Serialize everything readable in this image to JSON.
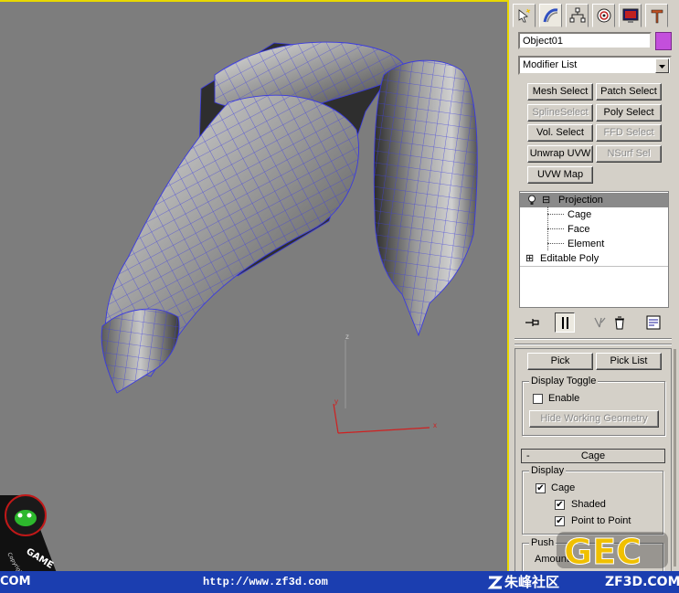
{
  "command_panel": {
    "tabs": [
      "create-icon",
      "modify-icon",
      "hierarchy-icon",
      "motion-icon",
      "display-icon",
      "utilities-icon"
    ],
    "object_name": "Object01",
    "object_color": "#c34fdc",
    "modifier_list_label": "Modifier List",
    "modifier_buttons": [
      {
        "label": "Mesh Select",
        "enabled": true
      },
      {
        "label": "Patch Select",
        "enabled": true
      },
      {
        "label": "SplineSelect",
        "enabled": false
      },
      {
        "label": "Poly Select",
        "enabled": true
      },
      {
        "label": "Vol. Select",
        "enabled": true
      },
      {
        "label": "FFD Select",
        "enabled": false
      },
      {
        "label": "Unwrap UVW",
        "enabled": true
      },
      {
        "label": "NSurf Sel",
        "enabled": false
      },
      {
        "label": "UVW Map",
        "enabled": true
      }
    ],
    "stack": {
      "items": [
        {
          "label": "Projection",
          "expand": "⊟",
          "selected": true
        },
        {
          "label": "Cage",
          "sub": true
        },
        {
          "label": "Face",
          "sub": true
        },
        {
          "label": "Element",
          "sub": true
        },
        {
          "label": "Editable Poly",
          "expand": "⊞"
        }
      ]
    },
    "stack_toolbar": [
      "pin-stack-icon",
      "show-end-result-icon",
      "make-unique-icon",
      "remove-modifier-icon",
      "configure-sets-icon"
    ],
    "pick_buttons": [
      "Pick",
      "Pick List"
    ],
    "display_toggle": {
      "title": "Display Toggle",
      "enable_label": "Enable",
      "enable_checked": false,
      "hide_button": "Hide Working Geometry"
    },
    "cage_rollout": {
      "collapse_symbol": "-",
      "title": "Cage",
      "display_group_title": "Display",
      "options": [
        {
          "label": "Cage",
          "checked": true
        },
        {
          "label": "Shaded",
          "checked": true
        },
        {
          "label": "Point to Point",
          "checked": true
        }
      ],
      "push_group_title": "Push",
      "amount_label": "Amount"
    }
  },
  "viewport": {
    "axis_labels": [
      "z",
      "y",
      "x"
    ],
    "background": "#7d7d7d",
    "wire_color": "#3f3fe8"
  },
  "watermark": {
    "game_text": "GAME",
    "copyright_text": "Copyright ©",
    "gec_text": "GEC"
  },
  "footer": {
    "left_text": "COM",
    "url": "http://www.zf3d.com",
    "site_name": "朱峰社区",
    "site_domain": "ZF3D.COM"
  }
}
